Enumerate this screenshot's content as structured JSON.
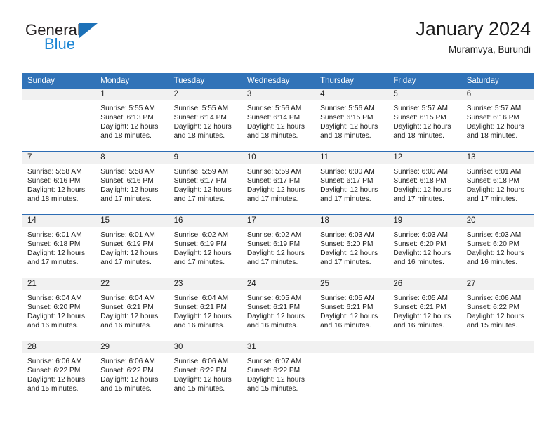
{
  "brand": {
    "name_top": "General",
    "name_bottom": "Blue",
    "triangle_color": "#1c71b8",
    "blue_color": "#1c86d4"
  },
  "header": {
    "title": "January 2024",
    "subtitle": "Muramvya, Burundi"
  },
  "theme": {
    "header_row_bg": "#3173b8",
    "week_divider": "#2e6db4",
    "daynum_band_bg": "#f1f1f1",
    "text": "#1a1a1a"
  },
  "weekday_headers": [
    "Sunday",
    "Monday",
    "Tuesday",
    "Wednesday",
    "Thursday",
    "Friday",
    "Saturday"
  ],
  "weeks": [
    [
      {
        "day": "",
        "empty": true,
        "sunrise": "",
        "sunset": "",
        "daylight_line1": "",
        "daylight_line2": ""
      },
      {
        "day": "1",
        "empty": false,
        "sunrise": "Sunrise: 5:55 AM",
        "sunset": "Sunset: 6:13 PM",
        "daylight_line1": "Daylight: 12 hours",
        "daylight_line2": "and 18 minutes."
      },
      {
        "day": "2",
        "empty": false,
        "sunrise": "Sunrise: 5:55 AM",
        "sunset": "Sunset: 6:14 PM",
        "daylight_line1": "Daylight: 12 hours",
        "daylight_line2": "and 18 minutes."
      },
      {
        "day": "3",
        "empty": false,
        "sunrise": "Sunrise: 5:56 AM",
        "sunset": "Sunset: 6:14 PM",
        "daylight_line1": "Daylight: 12 hours",
        "daylight_line2": "and 18 minutes."
      },
      {
        "day": "4",
        "empty": false,
        "sunrise": "Sunrise: 5:56 AM",
        "sunset": "Sunset: 6:15 PM",
        "daylight_line1": "Daylight: 12 hours",
        "daylight_line2": "and 18 minutes."
      },
      {
        "day": "5",
        "empty": false,
        "sunrise": "Sunrise: 5:57 AM",
        "sunset": "Sunset: 6:15 PM",
        "daylight_line1": "Daylight: 12 hours",
        "daylight_line2": "and 18 minutes."
      },
      {
        "day": "6",
        "empty": false,
        "sunrise": "Sunrise: 5:57 AM",
        "sunset": "Sunset: 6:16 PM",
        "daylight_line1": "Daylight: 12 hours",
        "daylight_line2": "and 18 minutes."
      }
    ],
    [
      {
        "day": "7",
        "empty": false,
        "sunrise": "Sunrise: 5:58 AM",
        "sunset": "Sunset: 6:16 PM",
        "daylight_line1": "Daylight: 12 hours",
        "daylight_line2": "and 18 minutes."
      },
      {
        "day": "8",
        "empty": false,
        "sunrise": "Sunrise: 5:58 AM",
        "sunset": "Sunset: 6:16 PM",
        "daylight_line1": "Daylight: 12 hours",
        "daylight_line2": "and 17 minutes."
      },
      {
        "day": "9",
        "empty": false,
        "sunrise": "Sunrise: 5:59 AM",
        "sunset": "Sunset: 6:17 PM",
        "daylight_line1": "Daylight: 12 hours",
        "daylight_line2": "and 17 minutes."
      },
      {
        "day": "10",
        "empty": false,
        "sunrise": "Sunrise: 5:59 AM",
        "sunset": "Sunset: 6:17 PM",
        "daylight_line1": "Daylight: 12 hours",
        "daylight_line2": "and 17 minutes."
      },
      {
        "day": "11",
        "empty": false,
        "sunrise": "Sunrise: 6:00 AM",
        "sunset": "Sunset: 6:17 PM",
        "daylight_line1": "Daylight: 12 hours",
        "daylight_line2": "and 17 minutes."
      },
      {
        "day": "12",
        "empty": false,
        "sunrise": "Sunrise: 6:00 AM",
        "sunset": "Sunset: 6:18 PM",
        "daylight_line1": "Daylight: 12 hours",
        "daylight_line2": "and 17 minutes."
      },
      {
        "day": "13",
        "empty": false,
        "sunrise": "Sunrise: 6:01 AM",
        "sunset": "Sunset: 6:18 PM",
        "daylight_line1": "Daylight: 12 hours",
        "daylight_line2": "and 17 minutes."
      }
    ],
    [
      {
        "day": "14",
        "empty": false,
        "sunrise": "Sunrise: 6:01 AM",
        "sunset": "Sunset: 6:18 PM",
        "daylight_line1": "Daylight: 12 hours",
        "daylight_line2": "and 17 minutes."
      },
      {
        "day": "15",
        "empty": false,
        "sunrise": "Sunrise: 6:01 AM",
        "sunset": "Sunset: 6:19 PM",
        "daylight_line1": "Daylight: 12 hours",
        "daylight_line2": "and 17 minutes."
      },
      {
        "day": "16",
        "empty": false,
        "sunrise": "Sunrise: 6:02 AM",
        "sunset": "Sunset: 6:19 PM",
        "daylight_line1": "Daylight: 12 hours",
        "daylight_line2": "and 17 minutes."
      },
      {
        "day": "17",
        "empty": false,
        "sunrise": "Sunrise: 6:02 AM",
        "sunset": "Sunset: 6:19 PM",
        "daylight_line1": "Daylight: 12 hours",
        "daylight_line2": "and 17 minutes."
      },
      {
        "day": "18",
        "empty": false,
        "sunrise": "Sunrise: 6:03 AM",
        "sunset": "Sunset: 6:20 PM",
        "daylight_line1": "Daylight: 12 hours",
        "daylight_line2": "and 17 minutes."
      },
      {
        "day": "19",
        "empty": false,
        "sunrise": "Sunrise: 6:03 AM",
        "sunset": "Sunset: 6:20 PM",
        "daylight_line1": "Daylight: 12 hours",
        "daylight_line2": "and 16 minutes."
      },
      {
        "day": "20",
        "empty": false,
        "sunrise": "Sunrise: 6:03 AM",
        "sunset": "Sunset: 6:20 PM",
        "daylight_line1": "Daylight: 12 hours",
        "daylight_line2": "and 16 minutes."
      }
    ],
    [
      {
        "day": "21",
        "empty": false,
        "sunrise": "Sunrise: 6:04 AM",
        "sunset": "Sunset: 6:20 PM",
        "daylight_line1": "Daylight: 12 hours",
        "daylight_line2": "and 16 minutes."
      },
      {
        "day": "22",
        "empty": false,
        "sunrise": "Sunrise: 6:04 AM",
        "sunset": "Sunset: 6:21 PM",
        "daylight_line1": "Daylight: 12 hours",
        "daylight_line2": "and 16 minutes."
      },
      {
        "day": "23",
        "empty": false,
        "sunrise": "Sunrise: 6:04 AM",
        "sunset": "Sunset: 6:21 PM",
        "daylight_line1": "Daylight: 12 hours",
        "daylight_line2": "and 16 minutes."
      },
      {
        "day": "24",
        "empty": false,
        "sunrise": "Sunrise: 6:05 AM",
        "sunset": "Sunset: 6:21 PM",
        "daylight_line1": "Daylight: 12 hours",
        "daylight_line2": "and 16 minutes."
      },
      {
        "day": "25",
        "empty": false,
        "sunrise": "Sunrise: 6:05 AM",
        "sunset": "Sunset: 6:21 PM",
        "daylight_line1": "Daylight: 12 hours",
        "daylight_line2": "and 16 minutes."
      },
      {
        "day": "26",
        "empty": false,
        "sunrise": "Sunrise: 6:05 AM",
        "sunset": "Sunset: 6:21 PM",
        "daylight_line1": "Daylight: 12 hours",
        "daylight_line2": "and 16 minutes."
      },
      {
        "day": "27",
        "empty": false,
        "sunrise": "Sunrise: 6:06 AM",
        "sunset": "Sunset: 6:22 PM",
        "daylight_line1": "Daylight: 12 hours",
        "daylight_line2": "and 15 minutes."
      }
    ],
    [
      {
        "day": "28",
        "empty": false,
        "sunrise": "Sunrise: 6:06 AM",
        "sunset": "Sunset: 6:22 PM",
        "daylight_line1": "Daylight: 12 hours",
        "daylight_line2": "and 15 minutes."
      },
      {
        "day": "29",
        "empty": false,
        "sunrise": "Sunrise: 6:06 AM",
        "sunset": "Sunset: 6:22 PM",
        "daylight_line1": "Daylight: 12 hours",
        "daylight_line2": "and 15 minutes."
      },
      {
        "day": "30",
        "empty": false,
        "sunrise": "Sunrise: 6:06 AM",
        "sunset": "Sunset: 6:22 PM",
        "daylight_line1": "Daylight: 12 hours",
        "daylight_line2": "and 15 minutes."
      },
      {
        "day": "31",
        "empty": false,
        "sunrise": "Sunrise: 6:07 AM",
        "sunset": "Sunset: 6:22 PM",
        "daylight_line1": "Daylight: 12 hours",
        "daylight_line2": "and 15 minutes."
      },
      {
        "day": "",
        "empty": true,
        "sunrise": "",
        "sunset": "",
        "daylight_line1": "",
        "daylight_line2": ""
      },
      {
        "day": "",
        "empty": true,
        "sunrise": "",
        "sunset": "",
        "daylight_line1": "",
        "daylight_line2": ""
      },
      {
        "day": "",
        "empty": true,
        "sunrise": "",
        "sunset": "",
        "daylight_line1": "",
        "daylight_line2": ""
      }
    ]
  ]
}
